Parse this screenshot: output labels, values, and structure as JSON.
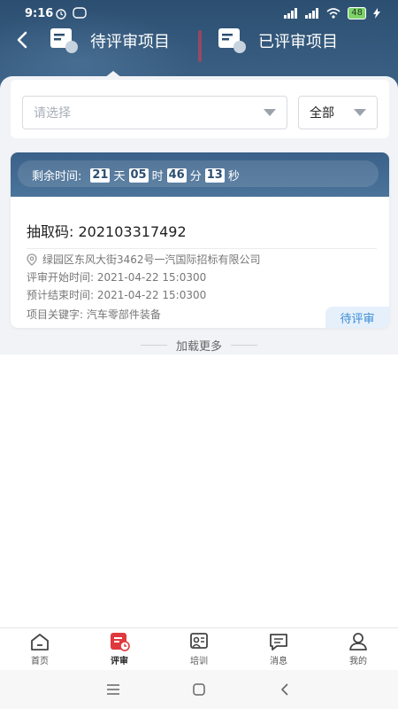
{
  "status_bar": {
    "time": "9:16",
    "battery": "48"
  },
  "header": {
    "tabs": [
      {
        "label": "待评审项目",
        "active": true
      },
      {
        "label": "已评审项目",
        "active": false
      }
    ]
  },
  "filters": {
    "select_placeholder": "请选择",
    "scope_value": "全部"
  },
  "project": {
    "countdown": {
      "label": "剩余时间:",
      "days": "21",
      "days_unit": "天",
      "hours": "05",
      "hours_unit": "时",
      "minutes": "46",
      "minutes_unit": "分",
      "seconds": "13",
      "seconds_unit": "秒"
    },
    "code_label": "抽取码:",
    "code": "202103317492",
    "address": "绿园区东风大街3462号一汽国际招标有限公司",
    "start_time": "评审开始时间: 2021-04-22 15:0300",
    "end_time": "预计结束时间: 2021-04-22 15:0300",
    "keywords": "项目关键字: 汽车零部件装备",
    "status": "待评审"
  },
  "load_more": "加载更多",
  "tabbar": [
    {
      "label": "首页",
      "icon": "home-icon",
      "active": false
    },
    {
      "label": "评审",
      "icon": "review-icon",
      "active": true
    },
    {
      "label": "培训",
      "icon": "training-icon",
      "active": false
    },
    {
      "label": "消息",
      "icon": "message-icon",
      "active": false
    },
    {
      "label": "我的",
      "icon": "profile-icon",
      "active": false
    }
  ],
  "colors": {
    "header": "#2c4f71",
    "accent_red": "#e0393e",
    "badge_text": "#3a8bd6"
  }
}
